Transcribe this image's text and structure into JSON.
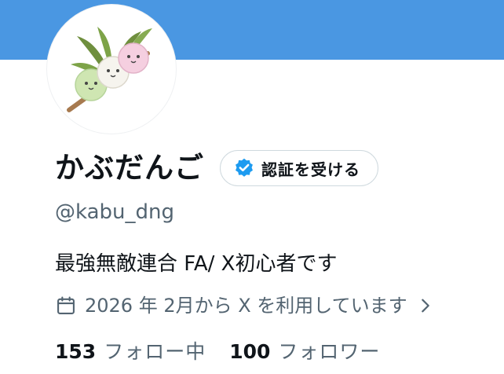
{
  "colors": {
    "banner": "#4a97e2",
    "text_primary": "#0f1419",
    "text_secondary": "#536471",
    "verified_badge": "#1d9bf0",
    "button_border": "#cfd9de"
  },
  "profile": {
    "avatar_icon": "dango-avatar",
    "display_name": "かぶだんご",
    "verify_button_label": "認証を受ける",
    "verify_icon": "verified-badge-icon",
    "handle": "@kabu_dng",
    "bio": "最強無敵連合 FA/ X初心者です",
    "joined_icon": "calendar-icon",
    "joined_text": "2026 年 2月から X を利用しています",
    "joined_chevron_icon": "chevron-right-icon"
  },
  "stats": {
    "following_count": "153",
    "following_label": "フォロー中",
    "followers_count": "100",
    "followers_label": "フォロワー"
  }
}
